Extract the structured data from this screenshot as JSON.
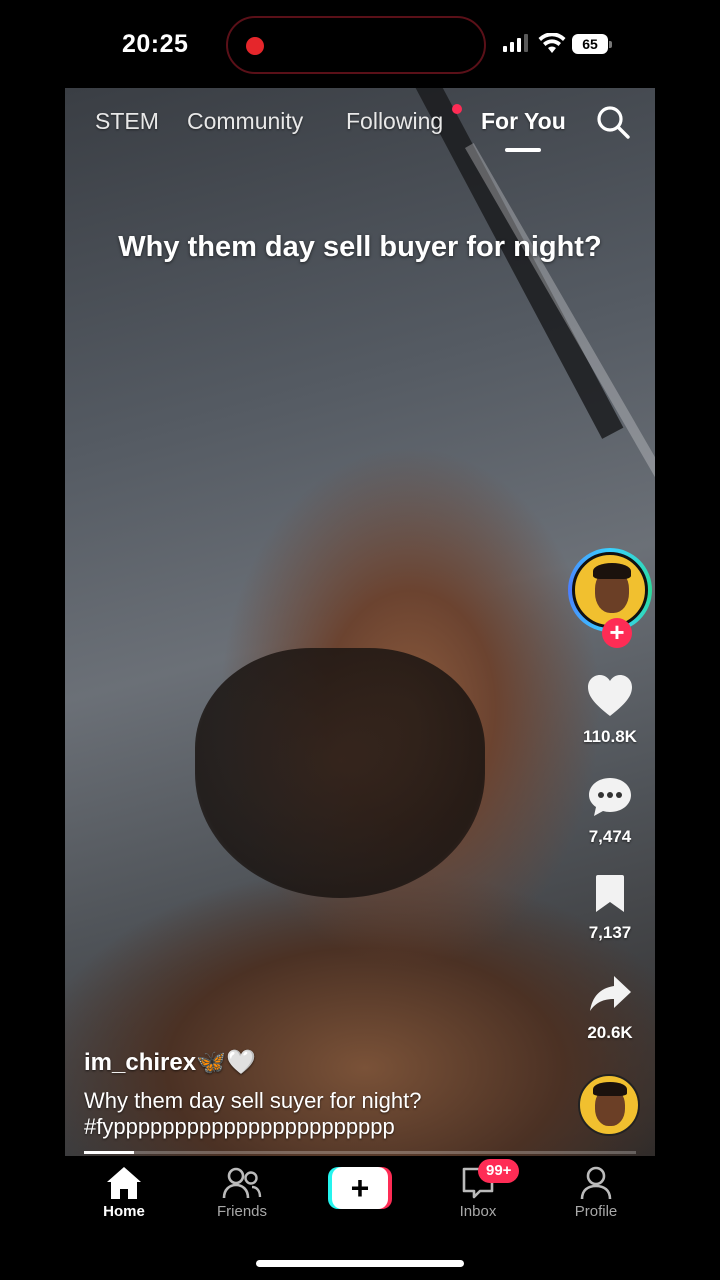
{
  "status_bar": {
    "time": "20:25",
    "battery": "65"
  },
  "top_nav": {
    "tabs": [
      "STEM",
      "Community",
      "Following",
      "For You"
    ],
    "active_tab": "For You"
  },
  "video": {
    "overlay_caption": "Why them day sell buyer for night?",
    "username": "im_chirex",
    "username_emoji": "🦋🤍",
    "description": "Why them day sell suyer for night?",
    "hashtags": "#fyppppppppppppppppppppppp",
    "progress": 0.09
  },
  "actions": {
    "likes": "110.8K",
    "comments": "7,474",
    "saves": "7,137",
    "shares": "20.6K",
    "follow_symbol": "+"
  },
  "bottom_nav": {
    "items": [
      "Home",
      "Friends",
      "+",
      "Inbox",
      "Profile"
    ],
    "active": "Home",
    "inbox_badge": "99+"
  },
  "colors": {
    "accent": "#fe2c55",
    "cyan": "#25f4ee",
    "ring": "#3ad1ff"
  },
  "icons": [
    "search-icon",
    "heart-icon",
    "comment-icon",
    "bookmark-icon",
    "share-icon",
    "home-icon",
    "friends-icon",
    "inbox-icon",
    "profile-icon"
  ]
}
